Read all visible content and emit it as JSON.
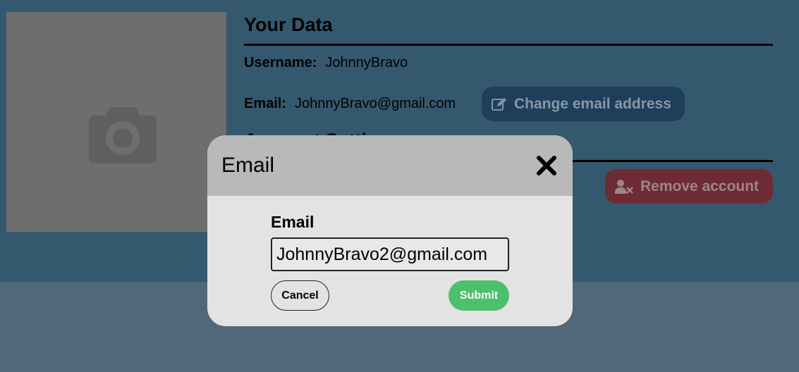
{
  "profile": {
    "photo_icon": "camera-icon"
  },
  "data_section": {
    "title": "Your Data",
    "username_label": "Username:",
    "username_value": "JohnnyBravo",
    "email_label": "Email:",
    "email_value": "JohnnyBravo@gmail.com",
    "change_email_button": "Change email address",
    "change_email_icon": "edit-icon"
  },
  "account_section": {
    "title": "Account Settings",
    "remove_button": "Remove account",
    "remove_icon": "user-remove-icon"
  },
  "modal": {
    "title": "Email",
    "close_icon": "close-icon",
    "field_label": "Email",
    "input_value": "JohnnyBravo2@gmail.com",
    "cancel_label": "Cancel",
    "submit_label": "Submit"
  },
  "colors": {
    "top_panel": "#34596f",
    "lower_background": "#526878",
    "change_button": "#1d3f5c",
    "remove_button": "#6e2b33",
    "submit_button": "#4cc06c",
    "modal_header": "#b9b9b9"
  }
}
